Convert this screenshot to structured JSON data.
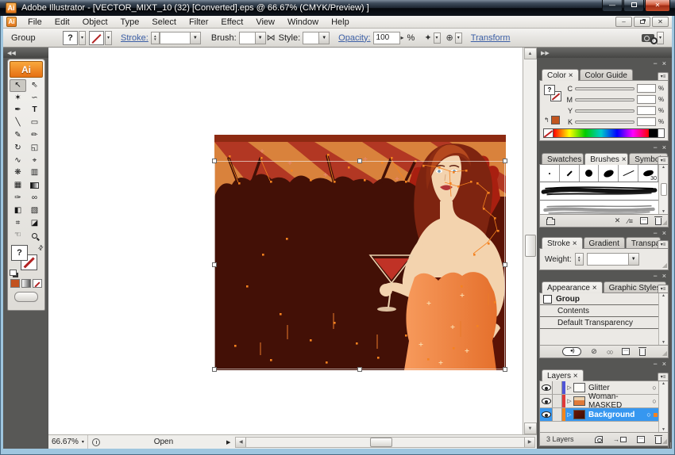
{
  "window": {
    "title": "Adobe Illustrator - [VECTOR_MIXT_10 (32) [Converted].eps @ 66.67% (CMYK/Preview) ]",
    "logo": "Ai"
  },
  "menu": {
    "items": [
      "File",
      "Edit",
      "Object",
      "Type",
      "Select",
      "Filter",
      "Effect",
      "View",
      "Window",
      "Help"
    ]
  },
  "control_bar": {
    "selection_type": "Group",
    "fill_value": "?",
    "stroke_label": "Stroke:",
    "brush_label": "Brush:",
    "style_label": "Style:",
    "opacity_label": "Opacity:",
    "opacity_value": "100",
    "opacity_unit": "%",
    "transform_label": "Transform"
  },
  "toolbar": {
    "logo": "Ai",
    "tools": [
      {
        "name": "selection-tool",
        "glyph": "↖"
      },
      {
        "name": "direct-selection-tool",
        "glyph": "⇖"
      },
      {
        "name": "magic-wand-tool",
        "glyph": "✶"
      },
      {
        "name": "lasso-tool",
        "glyph": "∽"
      },
      {
        "name": "pen-tool",
        "glyph": "✒"
      },
      {
        "name": "type-tool",
        "glyph": "T"
      },
      {
        "name": "line-segment-tool",
        "glyph": "╲"
      },
      {
        "name": "rectangle-tool",
        "glyph": "▭"
      },
      {
        "name": "paintbrush-tool",
        "glyph": "✎"
      },
      {
        "name": "pencil-tool",
        "glyph": "✏"
      },
      {
        "name": "rotate-tool",
        "glyph": "↻"
      },
      {
        "name": "scale-tool",
        "glyph": "◱"
      },
      {
        "name": "warp-tool",
        "glyph": "∿"
      },
      {
        "name": "free-transform-tool",
        "glyph": "⌖"
      },
      {
        "name": "symbol-sprayer-tool",
        "glyph": "❋"
      },
      {
        "name": "column-graph-tool",
        "glyph": "▥"
      },
      {
        "name": "mesh-tool",
        "glyph": "▦"
      },
      {
        "name": "gradient-tool",
        "glyph": ""
      },
      {
        "name": "eyedropper-tool",
        "glyph": "✑"
      },
      {
        "name": "blend-tool",
        "glyph": "∞"
      },
      {
        "name": "live-paint-bucket-tool",
        "glyph": "◧"
      },
      {
        "name": "live-paint-selection-tool",
        "glyph": "▧"
      },
      {
        "name": "crop-area-tool",
        "glyph": "⌗"
      },
      {
        "name": "eraser-tool",
        "glyph": "◪"
      },
      {
        "name": "hand-tool",
        "glyph": "☜"
      },
      {
        "name": "zoom-tool",
        "glyph": ""
      }
    ]
  },
  "panels": {
    "color": {
      "tabs": [
        "Color",
        "Color Guide"
      ],
      "channels": [
        {
          "label": "C",
          "value": ""
        },
        {
          "label": "M",
          "value": ""
        },
        {
          "label": "Y",
          "value": ""
        },
        {
          "label": "K",
          "value": ""
        }
      ],
      "unit": "%",
      "fill_value": "?"
    },
    "swatches_group": {
      "tabs": [
        "Swatches",
        "Brushes",
        "Symbols"
      ],
      "brush_size": "30"
    },
    "stroke": {
      "tabs": [
        "Stroke",
        "Gradient",
        "Transparency"
      ],
      "weight_label": "Weight:",
      "weight_value": ""
    },
    "appearance": {
      "tabs": [
        "Appearance",
        "Graphic Styles"
      ],
      "items": [
        "Group",
        "Contents",
        "Default Transparency"
      ]
    },
    "layers": {
      "tab": "Layers",
      "rows": [
        {
          "name": "Glitter",
          "color": "#5055D6"
        },
        {
          "name": "Woman-MASKED",
          "color": "#E03A3A"
        },
        {
          "name": "Background",
          "color": "#F2861E",
          "selected": true
        }
      ],
      "count": "3 Layers"
    }
  },
  "status_bar": {
    "zoom": "66.67%",
    "status": "Open"
  },
  "ui": {
    "tab_close": "×",
    "panel_minimize": "−",
    "panel_close": "×",
    "dropdown": "▾",
    "combo_arrow": "▼",
    "spinner_up": "▲",
    "spinner_down": "▼",
    "collapse_left": "◀◀",
    "collapse_right": "▶▶",
    "scroll_up": "▲",
    "scroll_down": "▼",
    "scroll_left": "◀",
    "scroll_right": "▶",
    "status_menu_arrow": "▶",
    "slider_popup_arrow": "▸",
    "target_circle": "○",
    "expand_arrow": "▷",
    "panel_menu": "▾≡",
    "swap_arrow": "⇄",
    "win_min": "—",
    "win_close": "✕",
    "recolor_glyph": "⋈",
    "isolate_glyph": "✦",
    "align_glyph": "⊕",
    "last_color_arrow": "↰",
    "clear_appearance": "⊘",
    "dup_circles": "○○",
    "pill_glyph": "●))",
    "remove_x": "✕",
    "options_glyph": "∕≡"
  },
  "colors": {
    "selection_blue": "#3697F0",
    "link_blue": "#3C5FA6",
    "accent_orange": "#F5821F",
    "layer_colors": [
      "#5055D6",
      "#E03A3A",
      "#F2861E"
    ],
    "artwork_palette": {
      "top_strip": "#8D2A12",
      "band": "#D9823C",
      "ray": "#B03422",
      "crowd": "#431006",
      "base": "#5B1306",
      "skin": "#F3D3AE",
      "hair": "#7E2410",
      "dress": "#EF8A44",
      "drink": "#C03226"
    }
  }
}
